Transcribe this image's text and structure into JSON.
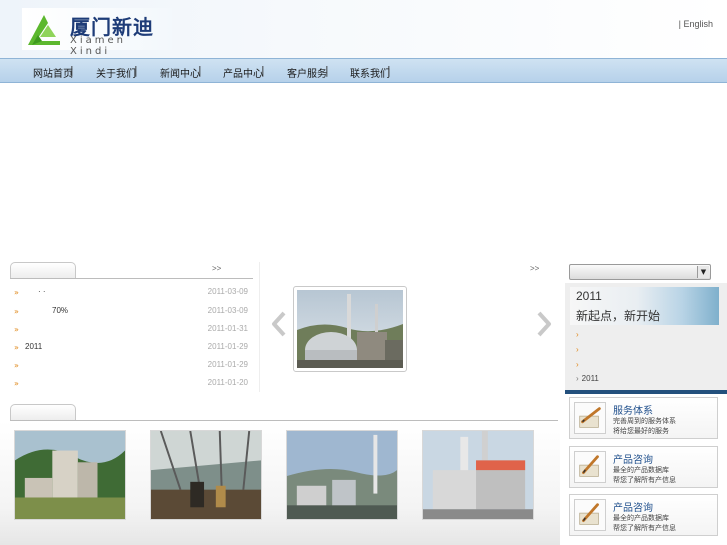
{
  "header": {
    "logo_cn": "厦门新迪",
    "logo_en": "Xiamen Xindi",
    "language_link": "| English"
  },
  "nav": {
    "items": [
      "网站首页",
      "关于我们",
      "新闻中心",
      "产品中心",
      "客户服务",
      "联系我们"
    ]
  },
  "news": {
    "more": ">>",
    "items": [
      {
        "title": "· ·",
        "date": "2011-03-09"
      },
      {
        "title": "70%",
        "date": "2011-03-09"
      },
      {
        "title": "",
        "date": "2011-01-31"
      },
      {
        "title": "2011",
        "date": "2011-01-29"
      },
      {
        "title": "",
        "date": "2011-01-29"
      },
      {
        "title": "",
        "date": "2011-01-20"
      }
    ]
  },
  "carousel": {
    "more": ">>"
  },
  "right": {
    "banner_year": "2011",
    "banner_text": "新起点，新开始",
    "items": [
      "",
      "",
      "",
      "2011"
    ],
    "services": [
      {
        "title": "服务体系",
        "line1": "完善周到的服务体系",
        "line2": "将给您最好的服务"
      },
      {
        "title": "产品咨询",
        "line1": "最全的产品数据库",
        "line2": "帮您了解所有产信息"
      },
      {
        "title": "产品咨询",
        "line1": "最全的产品数据库",
        "line2": "帮您了解所有产信息"
      }
    ]
  },
  "colors": {
    "nav_bg": "#c3daef",
    "bullet": "#e08a1e",
    "service_title": "#1f4f8c",
    "logo_green": "#5cb82e"
  },
  "icons": {
    "arrow_left": "chevron-left-icon",
    "arrow_right": "chevron-right-icon",
    "select_arrow": "caret-down-icon",
    "service": "pen-paper-icon"
  }
}
